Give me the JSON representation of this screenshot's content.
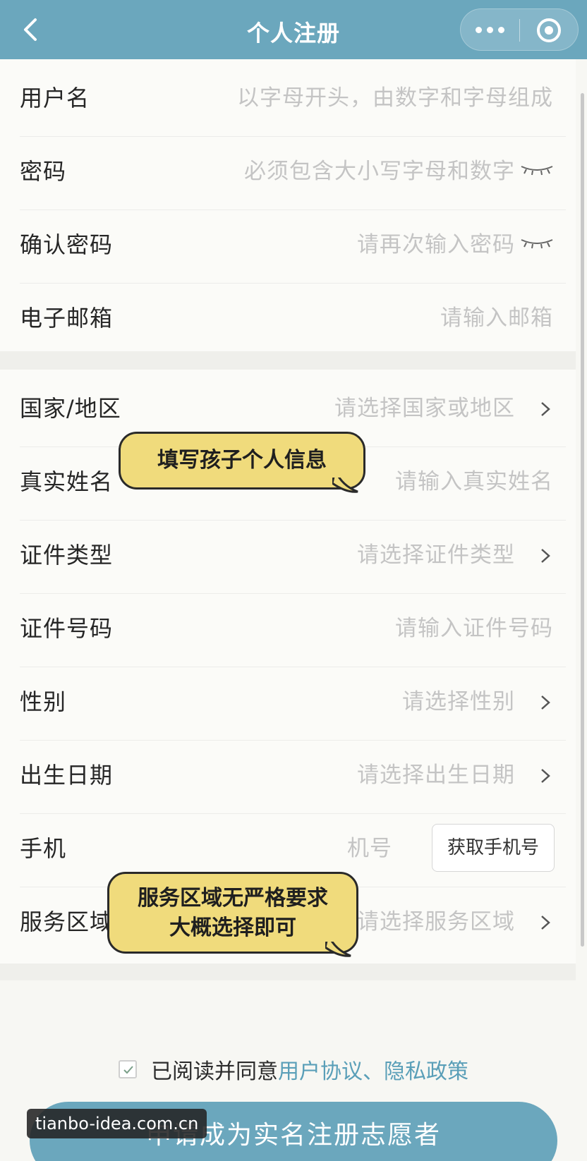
{
  "header": {
    "title": "个人注册",
    "bg_color": "#6ba7bd"
  },
  "form": {
    "account": [
      {
        "label": "用户名",
        "placeholder": "以字母开头，由数字和字母组成",
        "trail": "none"
      },
      {
        "label": "密码",
        "placeholder": "必须包含大小写字母和数字",
        "trail": "eye-closed-icon"
      },
      {
        "label": "确认密码",
        "placeholder": "请再次输入密码",
        "trail": "eye-closed-icon"
      },
      {
        "label": "电子邮箱",
        "placeholder": "请输入邮箱",
        "trail": "none"
      }
    ],
    "personal": [
      {
        "label": "国家/地区",
        "placeholder": "请选择国家或地区",
        "trail": "chevron-right-icon"
      },
      {
        "label": "真实姓名",
        "placeholder": "请输入真实姓名",
        "trail": "none"
      },
      {
        "label": "证件类型",
        "placeholder": "请选择证件类型",
        "trail": "chevron-right-icon"
      },
      {
        "label": "证件号码",
        "placeholder": "请输入证件号码",
        "trail": "none"
      },
      {
        "label": "性别",
        "placeholder": "请选择性别",
        "trail": "chevron-right-icon"
      },
      {
        "label": "出生日期",
        "placeholder": "请选择出生日期",
        "trail": "chevron-right-icon"
      },
      {
        "label": "手机",
        "placeholder": "机号",
        "trail": "button",
        "button_label": "获取手机号"
      },
      {
        "label": "服务区域",
        "placeholder": "请选择服务区域",
        "trail": "chevron-right-icon"
      }
    ]
  },
  "annotations": {
    "bubble1": "填写孩子个人信息",
    "bubble2_line1": "服务区域无严格要求",
    "bubble2_line2": "大概选择即可",
    "bubble_color": "#f0db7c"
  },
  "agreement": {
    "checked": true,
    "text": "已阅读并同意",
    "links": "用户协议、隐私政策",
    "link_color": "#5a9fb8"
  },
  "submit_label": "申请成为实名注册志愿者",
  "watermark": "tianbo-idea.com.cn"
}
